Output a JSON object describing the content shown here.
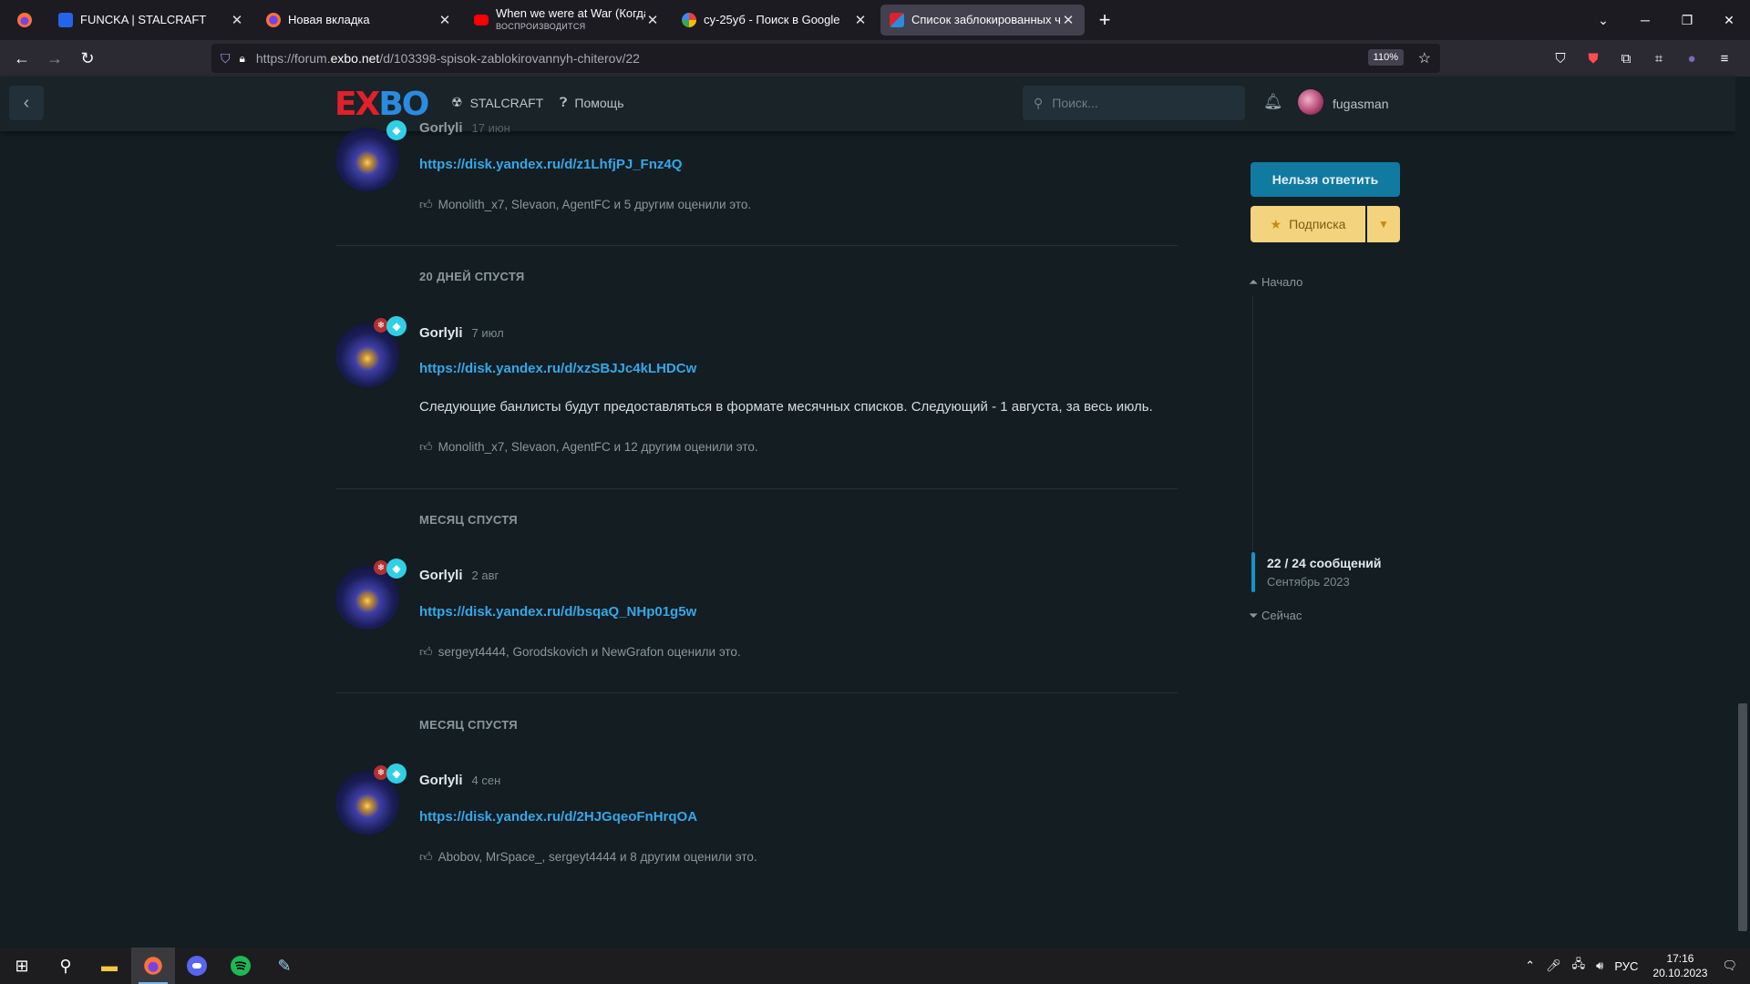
{
  "browser": {
    "tabs": [
      {
        "title": "FUNCKA | STALCRAFT",
        "subtitle": ""
      },
      {
        "title": "Новая вкладка",
        "subtitle": ""
      },
      {
        "title": "When we were at War (Когда м",
        "subtitle": "ВОСПРОИЗВОДИТСЯ"
      },
      {
        "title": "су-25уб - Поиск в Google",
        "subtitle": ""
      },
      {
        "title": "Список заблокированных чит",
        "subtitle": ""
      }
    ],
    "url_prefix": "https://forum.",
    "url_domain": "exbo.net",
    "url_path": "/d/103398-spisok-zablokirovannyh-chiterov/22",
    "zoom": "110%"
  },
  "header": {
    "logo_left": "EX",
    "logo_right": "BO",
    "nav_stalcraft": "STALCRAFT",
    "nav_help": "Помощь",
    "search_placeholder": "Поиск...",
    "username": "fugasman"
  },
  "posts": [
    {
      "author": "Gorlyli",
      "date": "17 июн",
      "link": "https://disk.yandex.ru/d/z1LhfjPJ_Fnz4Q",
      "text": "",
      "likes": "Monolith_x7, Slevaon, AgentFC и 5 другим оценили это."
    },
    {
      "author": "Gorlyli",
      "date": "7 июл",
      "link": "https://disk.yandex.ru/d/xzSBJJc4kLHDCw",
      "text": "Следующие банлисты будут предоставляться в формате месячных списков. Следующий - 1 августа, за весь июль.",
      "likes": "Monolith_x7, Slevaon, AgentFC и 12 другим оценили это."
    },
    {
      "author": "Gorlyli",
      "date": "2 авг",
      "link": "https://disk.yandex.ru/d/bsqaQ_NHp01g5w",
      "text": "",
      "likes": "sergeyt4444, Gorodskovich и NewGrafon оценили это."
    },
    {
      "author": "Gorlyli",
      "date": "4 сен",
      "link": "https://disk.yandex.ru/d/2HJGqeoFnHrqOA",
      "text": "",
      "likes": "Abobov, MrSpace_, sergeyt4444 и 8 другим оценили это."
    }
  ],
  "gaps": [
    "20 ДНЕЙ СПУСТЯ",
    "МЕСЯЦ СПУСТЯ",
    "МЕСЯЦ СПУСТЯ"
  ],
  "sidebar": {
    "reply_label": "Нельзя ответить",
    "subscribe_label": "Подписка",
    "scrub_top": "Начало",
    "scrub_count": "22 / 24 сообщений",
    "scrub_date": "Сентябрь 2023",
    "scrub_bottom": "Сейчас"
  },
  "taskbar": {
    "lang": "РУС",
    "time": "17:16",
    "date": "20.10.2023"
  }
}
